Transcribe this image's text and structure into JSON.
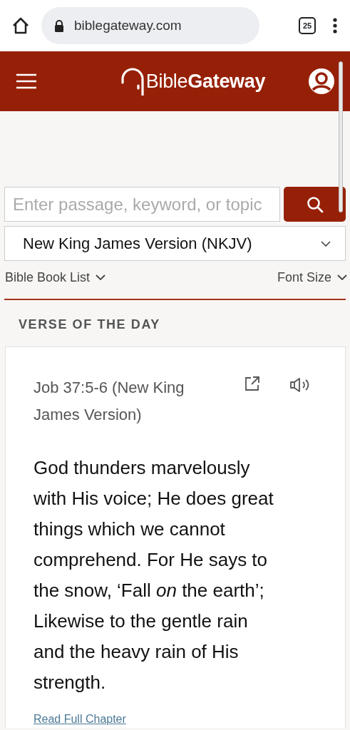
{
  "browser": {
    "url": "biblegateway.com",
    "tab_count": "25"
  },
  "header": {
    "logo": "Bible**Gateway**"
  },
  "search": {
    "placeholder": "Enter passage, keyword, or topic"
  },
  "version_select": {
    "value": "New King James Version (NKJV)"
  },
  "links": [
    {
      "label": "Bible Book List"
    },
    {
      "label": "Font Size"
    }
  ],
  "section_title": "VERSE OF THE DAY",
  "verse": {
    "reference": "Job 37:5-6 (New King James Version)",
    "text": "God thunders marvelously with His voice; He does great things which we cannot comprehend. For He says to the snow, ‘Fall *on* the earth’; Likewise to the gentle rain and the heavy rain of His strength.",
    "link": "Read Full Chapter"
  }
}
